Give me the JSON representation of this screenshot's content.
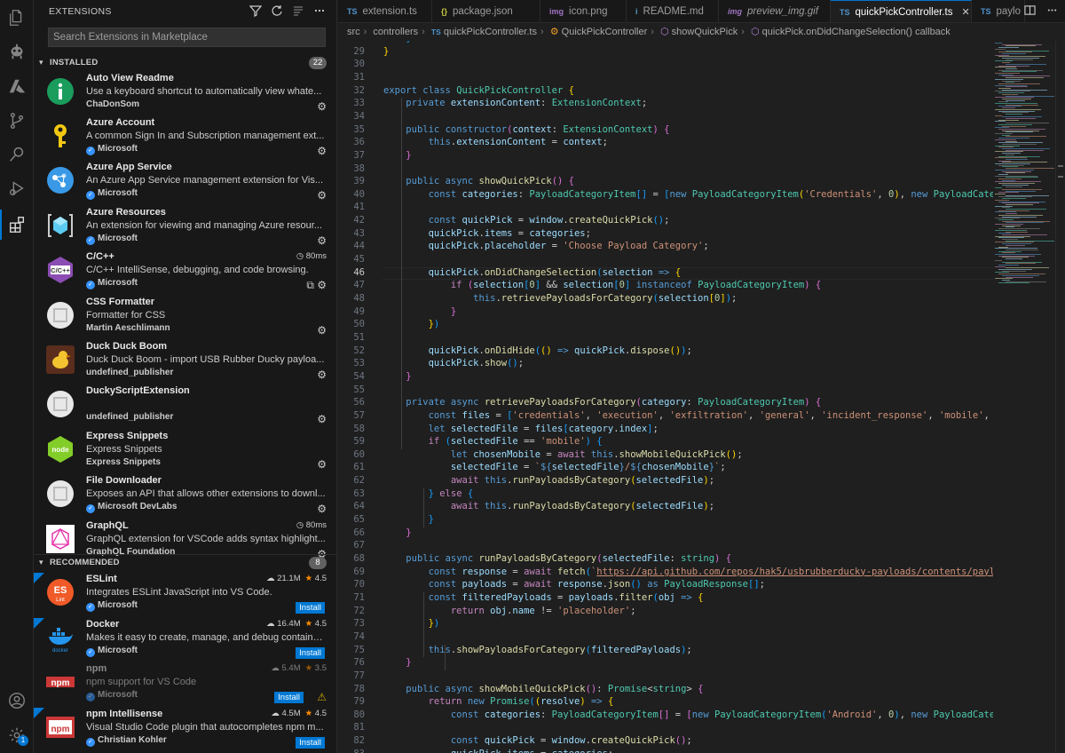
{
  "sidebar": {
    "title": "EXTENSIONS",
    "search_placeholder": "Search Extensions in Marketplace",
    "installed": {
      "label": "INSTALLED",
      "count": "22",
      "items": [
        {
          "name": "Auto View Readme",
          "desc": "Use a keyboard shortcut to automatically view whate...",
          "publisher": "ChaDonSom",
          "verified": false
        },
        {
          "name": "Azure Account",
          "desc": "A common Sign In and Subscription management ext...",
          "publisher": "Microsoft",
          "verified": true
        },
        {
          "name": "Azure App Service",
          "desc": "An Azure App Service management extension for Vis...",
          "publisher": "Microsoft",
          "verified": true
        },
        {
          "name": "Azure Resources",
          "desc": "An extension for viewing and managing Azure resour...",
          "publisher": "Microsoft",
          "verified": true
        },
        {
          "name": "C/C++",
          "desc": "C/C++ IntelliSense, debugging, and code browsing.",
          "publisher": "Microsoft",
          "verified": true,
          "perf": "80ms"
        },
        {
          "name": "CSS Formatter",
          "desc": "Formatter for CSS",
          "publisher": "Martin Aeschlimann",
          "verified": false
        },
        {
          "name": "Duck Duck Boom",
          "desc": "Duck Duck Boom - import USB Rubber Ducky payloa...",
          "publisher": "undefined_publisher",
          "verified": false
        },
        {
          "name": "DuckyScriptExtension",
          "desc": "",
          "publisher": "undefined_publisher",
          "verified": false
        },
        {
          "name": "Express Snippets",
          "desc": "Express Snippets",
          "publisher": "Express Snippets",
          "verified": false
        },
        {
          "name": "File Downloader",
          "desc": "Exposes an API that allows other extensions to downl...",
          "publisher": "Microsoft DevLabs",
          "verified": true
        },
        {
          "name": "GraphQL",
          "desc": "GraphQL extension for VSCode adds syntax highlight...",
          "publisher": "GraphQL Foundation",
          "verified": false,
          "perf": "80ms"
        }
      ]
    },
    "recommended": {
      "label": "RECOMMENDED",
      "count": "8",
      "items": [
        {
          "name": "ESLint",
          "desc": "Integrates ESLint JavaScript into VS Code.",
          "publisher": "Microsoft",
          "verified": true,
          "downloads": "21.1M",
          "rating": "4.5",
          "install": "Install"
        },
        {
          "name": "Docker",
          "desc": "Makes it easy to create, manage, and debug containe...",
          "publisher": "Microsoft",
          "verified": true,
          "downloads": "16.4M",
          "rating": "4.5",
          "install": "Install"
        },
        {
          "name": "npm",
          "desc": "npm support for VS Code",
          "publisher": "Microsoft",
          "verified": true,
          "downloads": "5.4M",
          "rating": "3.5",
          "install": "Install"
        },
        {
          "name": "npm Intellisense",
          "desc": "Visual Studio Code plugin that autocompletes npm m...",
          "publisher": "Christian Kohler",
          "verified": true,
          "downloads": "4.5M",
          "rating": "4.5",
          "install": "Install"
        }
      ]
    }
  },
  "tabs": [
    {
      "icon": "TS",
      "label": "extension.ts"
    },
    {
      "icon": "{}",
      "label": "package.json"
    },
    {
      "icon": "img",
      "label": "icon.png"
    },
    {
      "icon": "i",
      "label": "README.md"
    },
    {
      "icon": "img",
      "label": "preview_img.gif"
    },
    {
      "icon": "TS",
      "label": "quickPickController.ts",
      "active": true
    },
    {
      "icon": "TS",
      "label": "paylo"
    }
  ],
  "breadcrumb": {
    "parts": [
      "src",
      "controllers",
      "quickPickController.ts",
      "QuickPickController",
      "showQuickPick",
      "quickPick.onDidChangeSelection() callback"
    ]
  },
  "editor": {
    "current_line": 46,
    "lines": [
      {
        "n": 28,
        "html": "    <span class='b3'>}</span>"
      },
      {
        "n": 29,
        "html": "<span class='b1'>}</span>"
      },
      {
        "n": 30,
        "html": ""
      },
      {
        "n": 31,
        "html": ""
      },
      {
        "n": 32,
        "html": "<span class='k'>export</span> <span class='k'>class</span> <span class='t'>QuickPickController</span> <span class='b1'>{</span>"
      },
      {
        "n": 33,
        "html": "    <span class='k'>private</span> <span class='v'>extensionContent</span>: <span class='t'>ExtensionContext</span>;"
      },
      {
        "n": 34,
        "html": ""
      },
      {
        "n": 35,
        "html": "    <span class='k'>public</span> <span class='k'>constructor</span><span class='b2'>(</span><span class='v'>context</span>: <span class='t'>ExtensionContext</span><span class='b2'>)</span> <span class='b2'>{</span>"
      },
      {
        "n": 36,
        "html": "        <span class='k'>this</span>.<span class='v'>extensionContent</span> = <span class='v'>context</span>;"
      },
      {
        "n": 37,
        "html": "    <span class='b2'>}</span>"
      },
      {
        "n": 38,
        "html": ""
      },
      {
        "n": 39,
        "html": "    <span class='k'>public</span> <span class='k'>async</span> <span class='f'>showQuickPick</span><span class='b2'>()</span> <span class='b2'>{</span>"
      },
      {
        "n": 40,
        "html": "        <span class='k'>const</span> <span class='v'>categories</span>: <span class='t'>PayloadCategoryItem</span><span class='b3'>[]</span> = <span class='b3'>[</span><span class='k'>new</span> <span class='t'>PayloadCategoryItem</span><span class='b1'>(</span><span class='s'>'Credentials'</span>, <span class='n'>0</span><span class='b1'>)</span>, <span class='k'>new</span> <span class='t'>PayloadCategoryItem</span>"
      },
      {
        "n": 41,
        "html": ""
      },
      {
        "n": 42,
        "html": "        <span class='k'>const</span> <span class='v'>quickPick</span> = <span class='v'>window</span>.<span class='f'>createQuickPick</span><span class='b3'>()</span>;"
      },
      {
        "n": 43,
        "html": "        <span class='v'>quickPick</span>.<span class='v'>items</span> = <span class='v'>categories</span>;"
      },
      {
        "n": 44,
        "html": "        <span class='v'>quickPick</span>.<span class='v'>placeholder</span> = <span class='s'>'Choose Payload Category'</span>;"
      },
      {
        "n": 45,
        "html": ""
      },
      {
        "n": 46,
        "html": "        <span class='v'>quickPick</span>.<span class='f'>onDidChangeSelection</span><span class='b3'>(</span><span class='v'>selection</span> <span class='k'>=&gt;</span> <span class='b1'>{</span>"
      },
      {
        "n": 47,
        "html": "            <span class='c'>if</span> <span class='b2'>(</span><span class='v'>selection</span><span class='b3'>[</span><span class='n'>0</span><span class='b3'>]</span> &amp;&amp; <span class='v'>selection</span><span class='b3'>[</span><span class='n'>0</span><span class='b3'>]</span> <span class='k'>instanceof</span> <span class='t'>PayloadCategoryItem</span><span class='b2'>)</span> <span class='b2'>{</span>"
      },
      {
        "n": 48,
        "html": "                <span class='k'>this</span>.<span class='f'>retrievePayloadsForCategory</span><span class='b3'>(</span><span class='v'>selection</span><span class='b1'>[</span><span class='n'>0</span><span class='b1'>]</span><span class='b3'>)</span>;"
      },
      {
        "n": 49,
        "html": "            <span class='b2'>}</span>"
      },
      {
        "n": 50,
        "html": "        <span class='b1'>}</span><span class='b3'>)</span>"
      },
      {
        "n": 51,
        "html": ""
      },
      {
        "n": 52,
        "html": "        <span class='v'>quickPick</span>.<span class='f'>onDidHide</span><span class='b3'>(</span><span class='b1'>()</span> <span class='k'>=&gt;</span> <span class='v'>quickPick</span>.<span class='f'>dispose</span><span class='b1'>()</span><span class='b3'>)</span>;"
      },
      {
        "n": 53,
        "html": "        <span class='v'>quickPick</span>.<span class='f'>show</span><span class='b3'>()</span>;"
      },
      {
        "n": 54,
        "html": "    <span class='b2'>}</span>"
      },
      {
        "n": 55,
        "html": ""
      },
      {
        "n": 56,
        "html": "    <span class='k'>private</span> <span class='k'>async</span> <span class='f'>retrievePayloadsForCategory</span><span class='b2'>(</span><span class='v'>category</span>: <span class='t'>PayloadCategoryItem</span><span class='b2'>)</span> <span class='b2'>{</span>"
      },
      {
        "n": 57,
        "html": "        <span class='k'>const</span> <span class='v'>files</span> = <span class='b3'>[</span><span class='s'>'credentials'</span>, <span class='s'>'execution'</span>, <span class='s'>'exfiltration'</span>, <span class='s'>'general'</span>, <span class='s'>'incident_response'</span>, <span class='s'>'mobile'</span>, <span class='s'>'phishin</span>"
      },
      {
        "n": 58,
        "html": "        <span class='k'>let</span> <span class='v'>selectedFile</span> = <span class='v'>files</span><span class='b3'>[</span><span class='v'>category</span>.<span class='v'>index</span><span class='b3'>]</span>;"
      },
      {
        "n": 59,
        "html": "        <span class='c'>if</span> <span class='b3'>(</span><span class='v'>selectedFile</span> == <span class='s'>'mobile'</span><span class='b3'>)</span> <span class='b3'>{</span>"
      },
      {
        "n": 60,
        "html": "            <span class='k'>let</span> <span class='v'>chosenMobile</span> = <span class='c'>await</span> <span class='k'>this</span>.<span class='f'>showMobileQuickPick</span><span class='b1'>()</span>;"
      },
      {
        "n": 61,
        "html": "            <span class='v'>selectedFile</span> = <span class='s'>`</span><span class='k'>${</span><span class='v'>selectedFile</span><span class='k'>}</span><span class='s'>/</span><span class='k'>${</span><span class='v'>chosenMobile</span><span class='k'>}</span><span class='s'>`</span>;"
      },
      {
        "n": 62,
        "html": "            <span class='c'>await</span> <span class='k'>this</span>.<span class='f'>runPayloadsByCategory</span><span class='b1'>(</span><span class='v'>selectedFile</span><span class='b1'>)</span>;"
      },
      {
        "n": 63,
        "html": "        <span class='b3'>}</span> <span class='c'>else</span> <span class='b3'>{</span>"
      },
      {
        "n": 64,
        "html": "            <span class='c'>await</span> <span class='k'>this</span>.<span class='f'>runPayloadsByCategory</span><span class='b1'>(</span><span class='v'>selectedFile</span><span class='b1'>)</span>;"
      },
      {
        "n": 65,
        "html": "        <span class='b3'>}</span>"
      },
      {
        "n": 66,
        "html": "    <span class='b2'>}</span>"
      },
      {
        "n": 67,
        "html": ""
      },
      {
        "n": 68,
        "html": "    <span class='k'>public</span> <span class='k'>async</span> <span class='f'>runPayloadsByCategory</span><span class='b2'>(</span><span class='v'>selectedFile</span>: <span class='t'>string</span><span class='b2'>)</span> <span class='b2'>{</span>"
      },
      {
        "n": 69,
        "html": "        <span class='k'>const</span> <span class='v'>response</span> = <span class='c'>await</span> <span class='f'>fetch</span><span class='b3'>(</span><span class='s'>`</span><span class='u'>https://api.github.com/repos/hak5/usbrubberducky-payloads/contents/payloads/lib</span>"
      },
      {
        "n": 70,
        "html": "        <span class='k'>const</span> <span class='v'>payloads</span> = <span class='c'>await</span> <span class='v'>response</span>.<span class='f'>json</span><span class='b3'>()</span> <span class='k'>as</span> <span class='t'>PayloadResponse</span><span class='b3'>[]</span>;"
      },
      {
        "n": 71,
        "html": "        <span class='k'>const</span> <span class='v'>filteredPayloads</span> = <span class='v'>payloads</span>.<span class='f'>filter</span><span class='b3'>(</span><span class='v'>obj</span> <span class='k'>=&gt;</span> <span class='b1'>{</span>"
      },
      {
        "n": 72,
        "html": "            <span class='c'>return</span> <span class='v'>obj</span>.<span class='v'>name</span> != <span class='s'>'placeholder'</span>;"
      },
      {
        "n": 73,
        "html": "        <span class='b1'>}</span><span class='b3'>)</span>"
      },
      {
        "n": 74,
        "html": ""
      },
      {
        "n": 75,
        "html": "        <span class='k'>this</span>.<span class='f'>showPayloadsForCategory</span><span class='b3'>(</span><span class='v'>filteredPayloads</span><span class='b3'>)</span>;"
      },
      {
        "n": 76,
        "html": "    <span class='b2'>}</span>"
      },
      {
        "n": 77,
        "html": ""
      },
      {
        "n": 78,
        "html": "    <span class='k'>public</span> <span class='k'>async</span> <span class='f'>showMobileQuickPick</span><span class='b2'>()</span>: <span class='t'>Promise</span>&lt;<span class='t'>string</span>&gt; <span class='b2'>{</span>"
      },
      {
        "n": 79,
        "html": "        <span class='c'>return</span> <span class='k'>new</span> <span class='t'>Promise</span><span class='b3'>(</span><span class='b1'>(</span><span class='v'>resolve</span><span class='b1'>)</span> <span class='k'>=&gt;</span> <span class='b1'>{</span>"
      },
      {
        "n": 80,
        "html": "            <span class='k'>const</span> <span class='v'>categories</span>: <span class='t'>PayloadCategoryItem</span><span class='b2'>[]</span> = <span class='b2'>[</span><span class='k'>new</span> <span class='t'>PayloadCategoryItem</span><span class='b3'>(</span><span class='s'>'Android'</span>, <span class='n'>0</span><span class='b3'>)</span>, <span class='k'>new</span> <span class='t'>PayloadCategoryItem</span>"
      },
      {
        "n": 81,
        "html": ""
      },
      {
        "n": 82,
        "html": "            <span class='k'>const</span> <span class='v'>quickPick</span> = <span class='v'>window</span>.<span class='f'>createQuickPick</span><span class='b2'>()</span>;"
      },
      {
        "n": 83,
        "html": "            <span class='v'>quickPick</span>.<span class='v'>items</span> = <span class='v'>categories</span>;"
      }
    ]
  },
  "colors": {
    "accent": "#0078d4",
    "sidebar_bg": "#181818",
    "editor_bg": "#1f1f1f",
    "star": "#ff8e00",
    "warning": "#cca700"
  }
}
